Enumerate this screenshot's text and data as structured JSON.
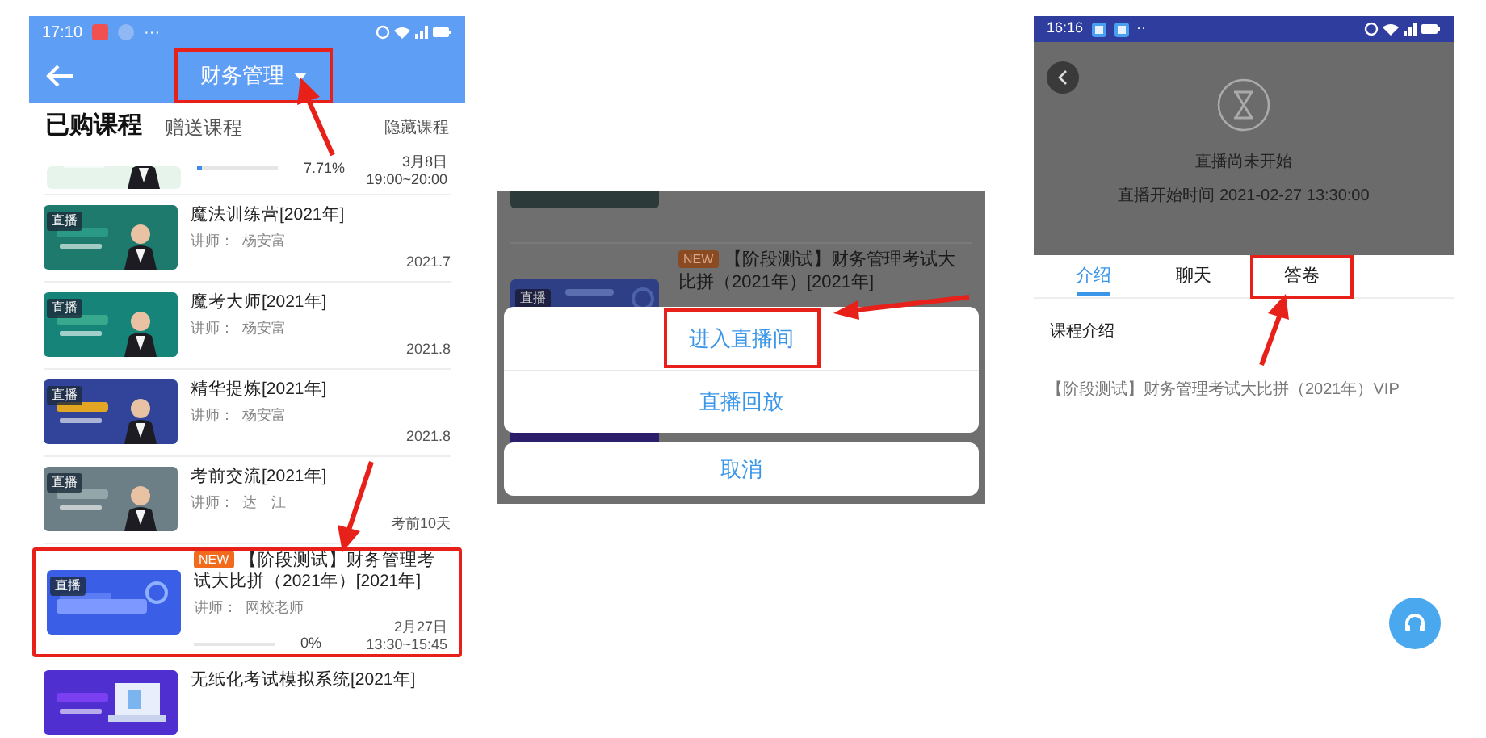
{
  "course_list_screen": {
    "status_bar": {
      "time": "17:10",
      "dots": "···"
    },
    "header": {
      "title": "财务管理",
      "highlighted": true
    },
    "tabs": [
      {
        "label": "已购课程",
        "selected": true
      },
      {
        "label": "赠送课程",
        "selected": false
      }
    ],
    "hidden_courses_link": "隐藏课程",
    "courses": [
      {
        "partial": true,
        "progress": {
          "level": 0.05,
          "reading": "7.71%"
        },
        "date": "3月8日",
        "time": "19:00~20:00",
        "highlighted": false
      },
      {
        "title": "魔法训练营[2021年]",
        "live_badge": "直播",
        "teacher": "讲师：  杨安富",
        "date": "2021.7",
        "highlighted": false
      },
      {
        "title": "魔考大师[2021年]",
        "live_badge": "直播",
        "teacher": "讲师：  杨安富",
        "date": "2021.8",
        "highlighted": false
      },
      {
        "title": "精华提炼[2021年]",
        "live_badge": "直播",
        "teacher": "讲师：  杨安富",
        "date": "2021.8",
        "highlighted": false
      },
      {
        "title": "考前交流[2021年]",
        "live_badge": "直播",
        "teacher": "讲师：  达　江",
        "date": "考前10天",
        "highlighted": false
      },
      {
        "new_tag": "NEW",
        "title": "【阶段测试】财务管理考试大比拼（2021年）[2021年]",
        "live_badge": "直播",
        "teacher": "讲师：  网校老师",
        "progress": {
          "level": 0,
          "reading": "0%"
        },
        "date": "2月27日",
        "time": "13:30~15:45",
        "highlighted": true
      },
      {
        "title": "无纸化考试模拟系统[2021年]",
        "highlighted": false
      }
    ]
  },
  "action_sheet_screen": {
    "background_course": {
      "new_tag": "NEW",
      "title": "【阶段测试】财务管理考试大比拼（2021年）[2021年]",
      "live_badge": "直播"
    },
    "actions": [
      {
        "label": "进入直播间",
        "highlighted": true
      },
      {
        "label": "直播回放",
        "highlighted": false
      }
    ],
    "cancel": "取消"
  },
  "live_room_screen": {
    "status_bar": {
      "time": "16:16",
      "dots": "··"
    },
    "player": {
      "message": "直播尚未开始",
      "start_time": "直播开始时间 2021-02-27 13:30:00"
    },
    "tabs": [
      {
        "label": "介绍",
        "selected": true,
        "highlighted": false
      },
      {
        "label": "聊天",
        "selected": false,
        "highlighted": false
      },
      {
        "label": "答卷",
        "selected": false,
        "highlighted": true
      }
    ],
    "section_title": "课程介绍",
    "description": "【阶段测试】财务管理考试大比拼（2021年）VIP"
  }
}
